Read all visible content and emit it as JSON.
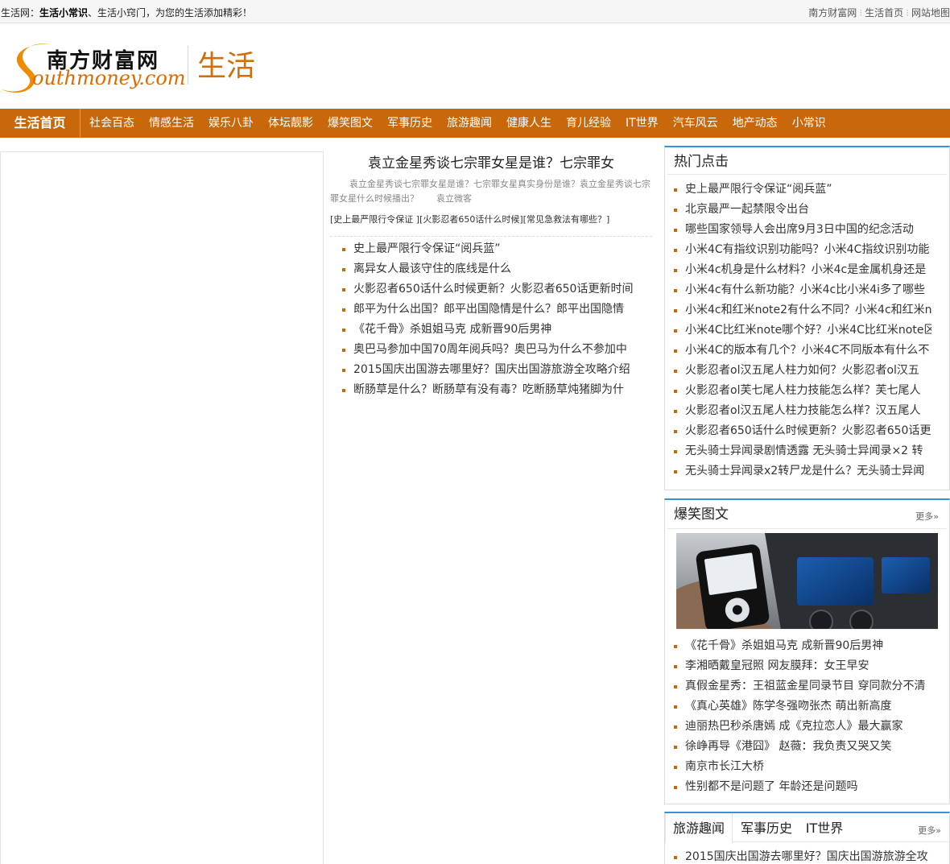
{
  "topbar": {
    "intro_prefix": "生活网：",
    "intro_bold": "生活小常识",
    "intro_suffix": "、生活小窍门，为您的生活添加精彩！",
    "links": [
      "南方财富网",
      "生活首页",
      "网站地图"
    ]
  },
  "header": {
    "logo_cn": "南方财富网",
    "logo_en": "outhmoney.com",
    "section_title": "生活"
  },
  "nav": {
    "home": "生活首页",
    "items": [
      "社会百态",
      "情感生活",
      "娱乐八卦",
      "体坛靓影",
      "爆笑图文",
      "军事历史",
      "旅游趣闻",
      "健康人生",
      "育儿经验",
      "IT世界",
      "汽车风云",
      "地产动态",
      "小常识"
    ]
  },
  "center": {
    "headline": "袁立金星秀谈七宗罪女星是谁？七宗罪女",
    "summary": "袁立金星秀谈七宗罪女星是谁？七宗罪女星真实身份是谁？袁立金星秀谈七宗罪女星什么时候播出？　　袁立微客",
    "tags": "[史上最严限行令保证 ][火影忍者650话什么时候][常见急救法有哪些？]",
    "list": [
      "史上最严限行令保证“阅兵蓝”",
      "离异女人最该守住的底线是什么",
      "火影忍者650话什么时候更新？火影忍者650话更新时间",
      "郎平为什么出国？郎平出国隐情是什么？郎平出国隐情",
      "《花千骨》杀姐姐马克 成新晋90后男神",
      "奥巴马参加中国70周年阅兵吗？奥巴马为什么不参加中",
      "2015国庆出国游去哪里好？国庆出国游旅游全攻略介绍",
      "断肠草是什么？断肠草有没有毒？吃断肠草炖猪脚为什"
    ]
  },
  "hot": {
    "title": "热门点击",
    "list": [
      "史上最严限行令保证“阅兵蓝”",
      "北京最严一起禁限令出台",
      "哪些国家领导人会出席9月3日中国的纪念活动",
      "小米4C有指纹识别功能吗？小米4C指纹识别功能",
      "小米4c机身是什么材料？小米4c是金属机身还是",
      "小米4c有什么新功能？小米4c比小米4i多了哪些",
      "小米4c和红米note2有什么不同？小米4c和红米n",
      "小米4C比红米note哪个好？小米4C比红米note区",
      "小米4C的版本有几个？小米4C不同版本有什么不",
      "火影忍者ol汉五尾人柱力如何？火影忍者ol汉五",
      "火影忍者ol芙七尾人柱力技能怎么样？芙七尾人",
      "火影忍者ol汉五尾人柱力技能怎么样？汉五尾人",
      "火影忍者650话什么时候更新？火影忍者650话更",
      "无头骑士异闻录剧情透露 无头骑士异闻录×2 转",
      "无头骑士异闻录x2转尸龙是什么？无头骑士异闻"
    ]
  },
  "joke": {
    "title": "爆笑图文",
    "more": "更多»",
    "list": [
      "《花千骨》杀姐姐马克 成新晋90后男神",
      "李湘晒戴皇冠照 网友膜拜：女王早安",
      "真假金星秀：王祖蓝金星同录节目 穿同款分不清",
      "《真心英雄》陈学冬强吻张杰 萌出新高度",
      "迪丽热巴秒杀唐嫣 成《克拉恋人》最大赢家",
      "徐峥再导《港囧》 赵薇：我负责又哭又笑",
      "南京市长江大桥",
      "性别都不是问题了 年龄还是问题吗"
    ]
  },
  "travel": {
    "tabs": [
      "旅游趣闻",
      "军事历史",
      "IT世界"
    ],
    "more": "更多»",
    "list": [
      "2015国庆出国游去哪里好？国庆出国游旅游全攻"
    ]
  }
}
